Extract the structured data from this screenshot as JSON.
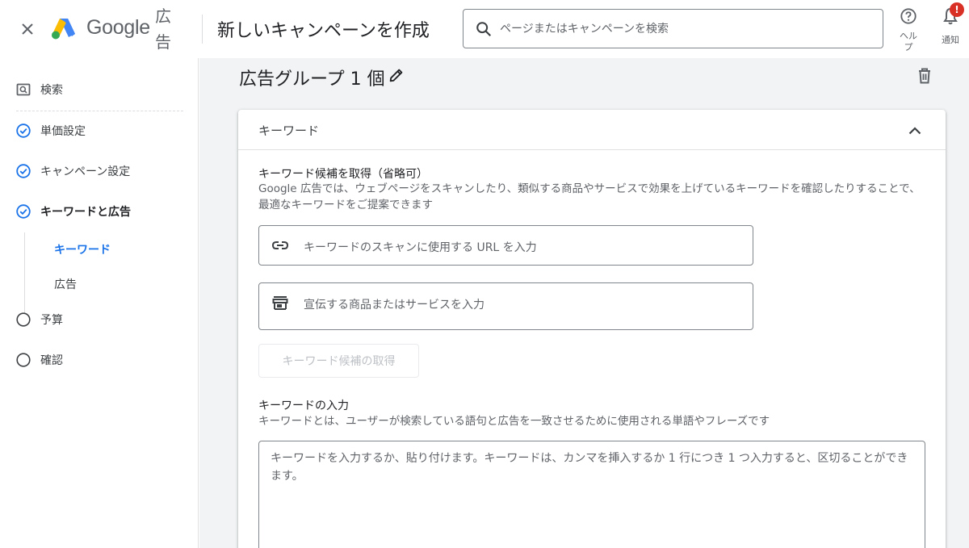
{
  "header": {
    "brand": "Google",
    "brand_sub": "広告",
    "page_title": "新しいキャンペーンを作成",
    "search_placeholder": "ページまたはキャンペーンを検索",
    "help_label": "ヘルプ",
    "notifications_label": "通知",
    "notification_badge": "!",
    "icons": [
      "close-icon",
      "google-ads-logo",
      "search-icon",
      "help-icon",
      "bell-icon"
    ]
  },
  "sidebar": {
    "items": [
      {
        "label": "検索",
        "icon": "search-box-icon",
        "status": "none"
      },
      {
        "label": "単価設定",
        "icon": "check-circle-icon",
        "status": "done"
      },
      {
        "label": "キャンペーン設定",
        "icon": "check-circle-icon",
        "status": "done"
      },
      {
        "label": "キーワードと広告",
        "icon": "check-circle-icon",
        "status": "current"
      },
      {
        "label": "予算",
        "icon": "empty-circle-icon",
        "status": "todo"
      },
      {
        "label": "確認",
        "icon": "empty-circle-icon",
        "status": "todo"
      }
    ],
    "sub_items": [
      {
        "label": "キーワード",
        "active": true
      },
      {
        "label": "広告",
        "active": false
      }
    ]
  },
  "main": {
    "ad_group_title": "広告グループ 1 個",
    "card": {
      "title": "キーワード",
      "suggest_title": "キーワード候補を取得（省略可）",
      "suggest_desc": "Google 広告では、ウェブページをスキャンしたり、類似する商品やサービスで効果を上げているキーワードを確認したりすることで、最適なキーワードをご提案できます",
      "url_placeholder": "キーワードのスキャンに使用する URL を入力",
      "product_placeholder": "宣伝する商品またはサービスを入力",
      "get_button": "キーワード候補の取得",
      "enter_title": "キーワードの入力",
      "enter_desc": "キーワードとは、ユーザーが検索している語句と広告を一致させるために使用される単語やフレーズです",
      "keywords_placeholder": "キーワードを入力するか、貼り付けます。キーワードは、カンマを挿入するか 1 行につき 1 つ入力すると、区切ることができます。"
    }
  },
  "colors": {
    "accent": "#1a73e8",
    "badge": "#d93025",
    "background": "#f1f3f4"
  }
}
